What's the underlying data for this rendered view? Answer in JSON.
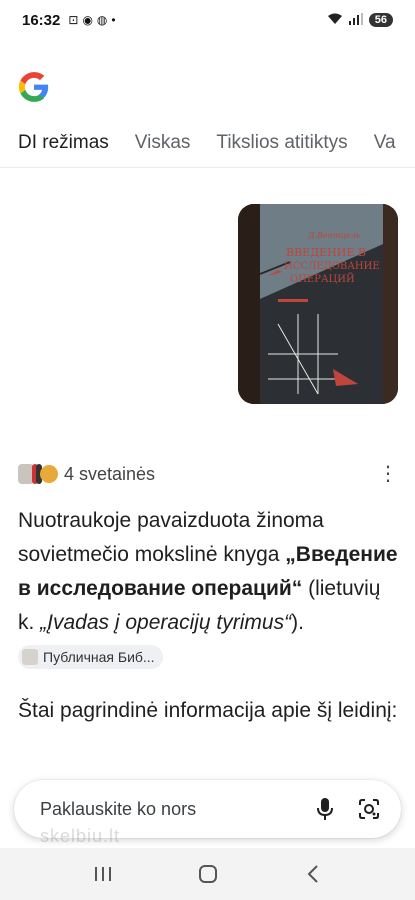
{
  "status": {
    "time": "16:32",
    "battery": "56"
  },
  "tabs": [
    {
      "label": "DI režimas",
      "active": true
    },
    {
      "label": "Viskas",
      "active": false
    },
    {
      "label": "Tikslios atitiktys",
      "active": false
    },
    {
      "label": "Va",
      "active": false
    }
  ],
  "image_card": {
    "book_title": "Введение в исследование операций",
    "book_author": "Д.Вентцель"
  },
  "sources": {
    "label": "4 svetainės"
  },
  "answer": {
    "line_prefix": "Nuotraukoje pavaizduota žinoma sovietmečio mokslinė knyga ",
    "book_bold": "„Введение в исследование операций“",
    "middle": " (lietuvių k. ",
    "italic": "„Įvadas į operacijų tyrimus“",
    "end": ").",
    "chip_label": "Публичная Биб..."
  },
  "intro": "Štai pagrindinė informacija apie šį leidinį:",
  "ask": {
    "placeholder": "Paklauskite ko nors"
  },
  "watermark": "skelbiu.lt"
}
